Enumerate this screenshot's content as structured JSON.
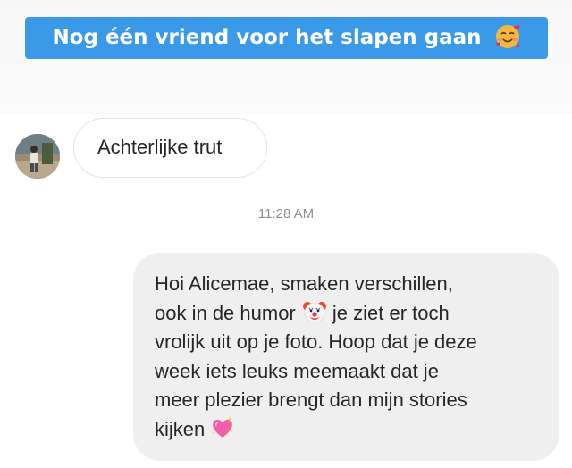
{
  "caption": {
    "text": "Nog één vriend voor het slapen gaan",
    "emoji_icon": "smiling-face-with-hearts-icon"
  },
  "contact": {
    "avatar_icon": "profile-photo-avatar"
  },
  "received_message": {
    "text": "Achterlijke trut"
  },
  "timestamp": "11:28 AM",
  "sent_message": {
    "line1": "Hoi Alicemae, smaken verschillen,",
    "line2a": "ook in de humor",
    "line2_emoji_icon": "clown-face-icon",
    "line2b": " je ziet er toch",
    "line3": "vrolijk uit op je foto. Hoop dat je deze",
    "line4": "week iets leuks meemaakt dat je",
    "line5": "meer plezier brengt dan mijn stories",
    "line6": "kijken",
    "line6_emoji_icon": "sparkling-heart-icon"
  },
  "colors": {
    "banner": "#3b9ae8",
    "sent_bubble": "#efefef",
    "received_border": "#e3e3e3",
    "text": "#262626",
    "timestamp": "#8e8e8e"
  }
}
